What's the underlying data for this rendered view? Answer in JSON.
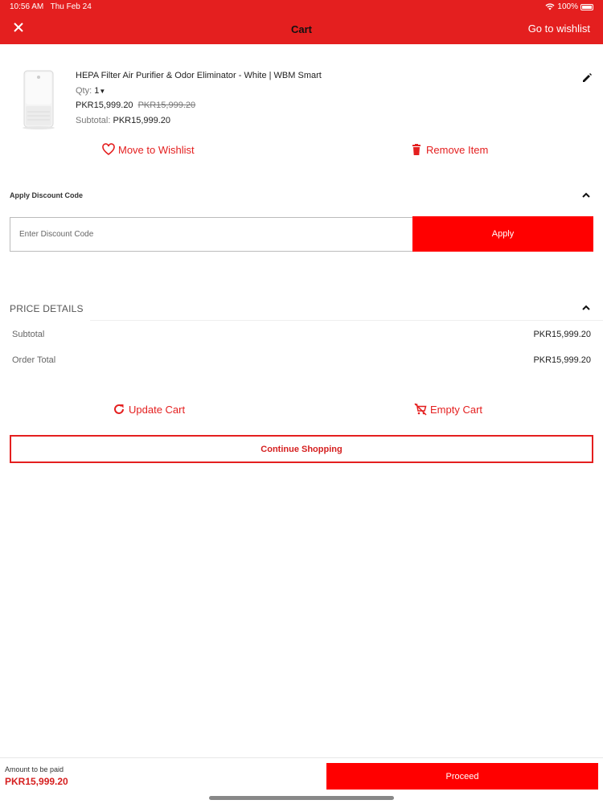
{
  "status_bar": {
    "time": "10:56 AM",
    "date": "Thu Feb 24",
    "battery": "100%"
  },
  "header": {
    "title": "Cart",
    "go_wishlist": "Go to wishlist",
    "close_icon": "close-icon"
  },
  "product": {
    "name": "HEPA Filter Air Purifier & Odor Eliminator - White | WBM Smart",
    "qty_label": "Qty:",
    "qty_value": "1",
    "price": "PKR15,999.20",
    "old_price": "PKR15,999.20",
    "subtotal_label": "Subtotal:",
    "subtotal_value": "PKR15,999.20"
  },
  "actions": {
    "move_to_wishlist": "Move to Wishlist",
    "remove_item": "Remove Item"
  },
  "discount": {
    "label": "Apply Discount Code",
    "placeholder": "Enter Discount Code",
    "apply": "Apply"
  },
  "price_details": {
    "title": "PRICE DETAILS",
    "rows": [
      {
        "label": "Subtotal",
        "value": "PKR15,999.20"
      },
      {
        "label": "Order Total",
        "value": "PKR15,999.20"
      }
    ]
  },
  "cart_actions": {
    "update_cart": "Update Cart",
    "empty_cart": "Empty Cart",
    "continue_shopping": "Continue Shopping"
  },
  "footer": {
    "amount_label": "Amount to be paid",
    "amount_value": "PKR15,999.20",
    "proceed": "Proceed"
  },
  "colors": {
    "brand_red": "#e41f1f",
    "button_red": "#ff0000"
  }
}
